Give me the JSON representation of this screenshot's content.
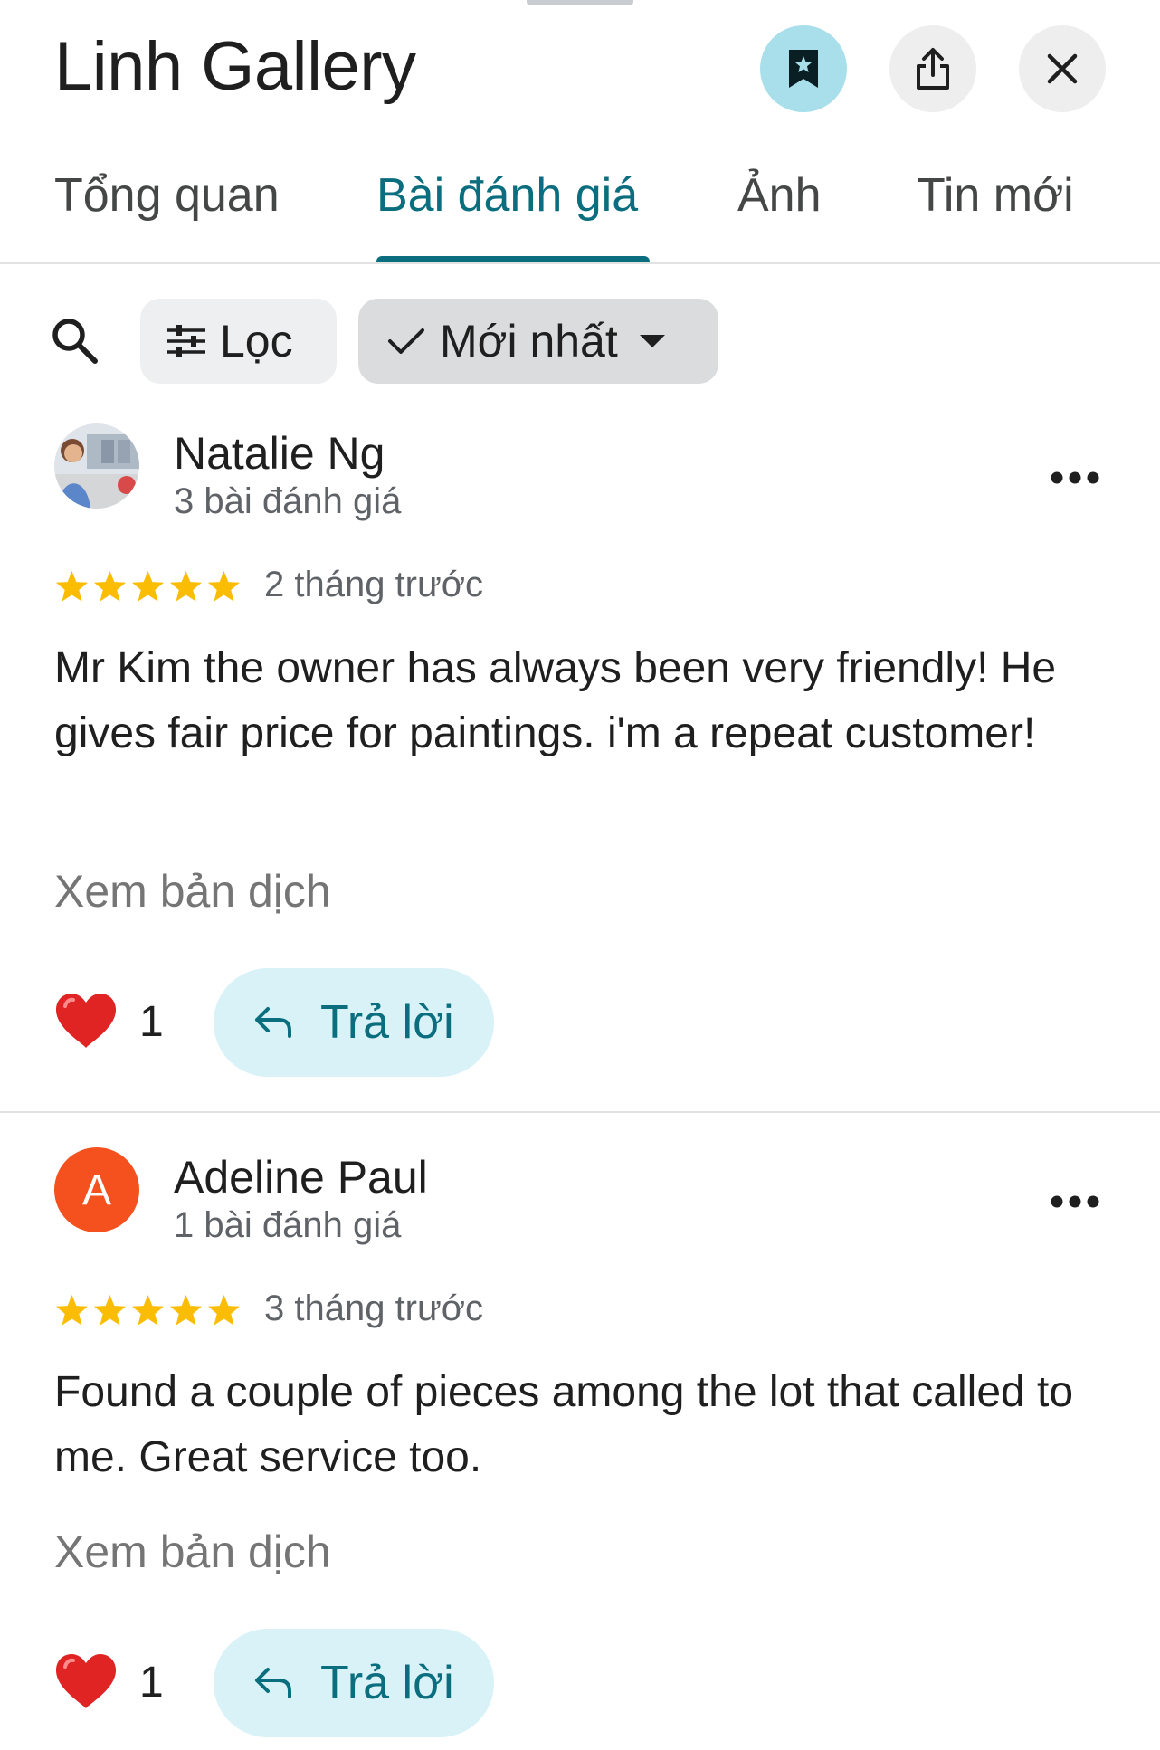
{
  "header": {
    "title": "Linh Gallery"
  },
  "icons": {
    "save": "bookmark-icon",
    "share": "share-icon",
    "close": "close-icon"
  },
  "colors": {
    "accent": "#0b6e7e",
    "save_bg": "#a8dfeb",
    "reply_bg": "#d8f2f7",
    "star": "#fbbc04"
  },
  "tabs": [
    {
      "label": "Tổng quan",
      "active": false
    },
    {
      "label": "Bài đánh giá",
      "active": true
    },
    {
      "label": "Ảnh",
      "active": false
    },
    {
      "label": "Tin mới",
      "active": false
    }
  ],
  "filters": {
    "filter_label": "Lọc",
    "sort_label": "Mới nhất"
  },
  "reviews": [
    {
      "avatar_letter": "",
      "name": "Natalie Ng",
      "review_count": "3 bài đánh giá",
      "rating": 5,
      "time": "2 tháng trước",
      "text": "Mr Kim the owner has always been very friendly! He gives fair price for paintings. i'm a repeat customer!",
      "translate_label": "Xem bản dịch",
      "likes": "1",
      "reply_label": "Trả lời"
    },
    {
      "avatar_letter": "A",
      "name": "Adeline Paul",
      "review_count": "1 bài đánh giá",
      "rating": 5,
      "time": "3 tháng trước",
      "text": "Found a couple of pieces among the lot that called to me. Great service too.",
      "translate_label": "Xem bản dịch",
      "likes": "1",
      "reply_label": "Trả lời"
    }
  ]
}
